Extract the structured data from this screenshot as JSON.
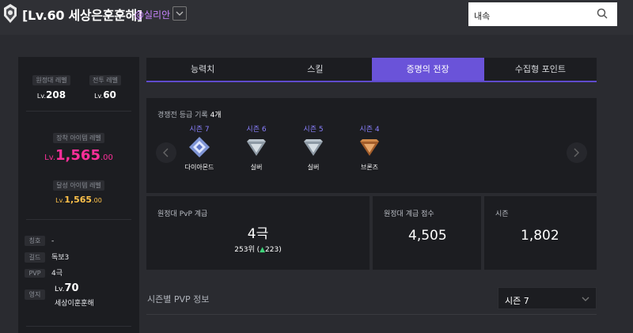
{
  "header": {
    "title": "[Lv.60 세상은훈훈해]",
    "handle": "@실리안",
    "search_value": "내속"
  },
  "profile": {
    "expedition_level_label": "원정대 레벨",
    "expedition_level_prefix": "Lv.",
    "expedition_level_value": "208",
    "combat_level_label": "전투 레벨",
    "combat_level_prefix": "Lv.",
    "combat_level_value": "60",
    "equipped_item_label": "장착 아이템 레벨",
    "equipped_item_prefix": "Lv.",
    "equipped_item_int": "1,565",
    "equipped_item_dec": ".00",
    "achieved_item_label": "달성 아이템 레벨",
    "achieved_item_prefix": "Lv.",
    "achieved_item_int": "1,565",
    "achieved_item_dec": ".00",
    "title_label": "칭호",
    "title_value": "-",
    "guild_label": "길드",
    "guild_value": "독보3",
    "pvp_label": "PVP",
    "pvp_value": "4극",
    "estate_label": "영지",
    "estate_level_prefix": "Lv.",
    "estate_level": "70",
    "estate_name": "세상이훈훈해"
  },
  "tabs": [
    {
      "label": "능력치",
      "active": false
    },
    {
      "label": "스킬",
      "active": false
    },
    {
      "label": "증명의 전장",
      "active": true
    },
    {
      "label": "수집형 포인트",
      "active": false
    }
  ],
  "history": {
    "label": "경쟁전 등급 기록",
    "count": "4개",
    "seasons": [
      {
        "season": "시즌 7",
        "rank": "다이아몬드",
        "icon": "diamond-rank-icon",
        "color": "#9fb3e8"
      },
      {
        "season": "시즌 6",
        "rank": "실버",
        "icon": "silver-rank-icon",
        "color": "#b9c3cc"
      },
      {
        "season": "시즌 5",
        "rank": "실버",
        "icon": "silver-rank-icon",
        "color": "#b9c3cc"
      },
      {
        "season": "시즌 4",
        "rank": "브론즈",
        "icon": "bronze-rank-icon",
        "color": "#d08a4a"
      }
    ]
  },
  "pvp": {
    "grade_label": "원정대 PvP 계급",
    "grade_value": "4극",
    "rank_text": "253위 (",
    "rank_change": "223",
    "rank_close": ")",
    "score_label": "원정대 계급 점수",
    "score_value": "4,505",
    "season_label": "시즌",
    "season_value": "1,802"
  },
  "season_pvp": {
    "title": "시즌별 PVP 정보",
    "selected": "시즌 7"
  },
  "colors": {
    "accent": "#6a53d9",
    "equipped_level": "#ff2f9a",
    "achieved_level": "#ffc24a",
    "handle": "#c884ff"
  }
}
